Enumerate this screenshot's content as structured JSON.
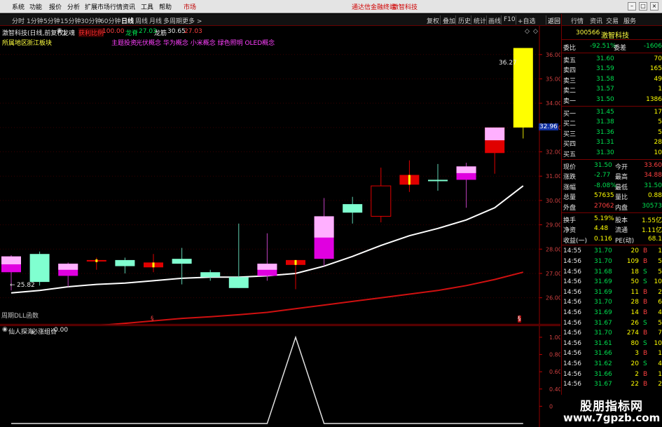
{
  "menu": {
    "items": [
      "系统",
      "功能",
      "报价",
      "分析",
      "扩展市场行情",
      "资讯",
      "工具",
      "帮助"
    ],
    "market": "市场",
    "title_app": "通达信金融终端",
    "title_stock": "激智科技"
  },
  "periods": [
    "分时",
    "1分钟",
    "5分钟",
    "15分钟",
    "30分钟",
    "60分钟",
    "日线",
    "周线",
    "月线",
    "多周期",
    "更多 >"
  ],
  "toolbar": [
    "复权",
    "叠加",
    "历史",
    "统计",
    "画线",
    "F10",
    "+自选",
    "返回"
  ],
  "chart_header": {
    "stock_line": "激智科技(日线,前复权)",
    "indicator_name": "龙魂",
    "buy_ratio_label": "获利比例",
    "buy_ratio_value": "100.00",
    "dragon_spirit_label": "龙脊",
    "dragon_spirit_value": "27.03",
    "dragon_tendon_label": "龙筋",
    "dragon_tendon_value": "30.65",
    "extra_value": "27.03",
    "region_label": "所属地区",
    "region_value": "浙江板块",
    "theme_label": "主题投资",
    "themes": "光伏概念 华为概念 小米概念 绿色照明 OLED概念"
  },
  "sub_header": {
    "name": "仙人探海",
    "formula": "必涨组合",
    "value": "0.00"
  },
  "volume_label": "周期DLL函数",
  "markers": {
    "high_label": "36.27",
    "low_label": "25.82",
    "current_price_tag": "32.96",
    "bottom_mark_left": "§",
    "bottom_mark_right": "§"
  },
  "chart_data": {
    "type": "candlestick",
    "title": "",
    "y_axis": {
      "min": 25.5,
      "max": 36.6,
      "ticks": [
        26.0,
        27.0,
        28.0,
        29.0,
        30.0,
        31.0,
        32.0,
        33.0,
        34.0,
        35.0,
        36.0
      ]
    },
    "candles": [
      {
        "open": 27.05,
        "high": 27.75,
        "low": 26.3,
        "close": 27.7,
        "color": "magenta"
      },
      {
        "open": 26.65,
        "high": 27.9,
        "low": 26.5,
        "close": 27.8,
        "color": "cyan"
      },
      {
        "open": 27.4,
        "high": 27.45,
        "low": 26.45,
        "close": 26.9,
        "color": "magenta"
      },
      {
        "open": 27.55,
        "high": 27.65,
        "low": 27.15,
        "close": 27.55,
        "color": "red"
      },
      {
        "open": 27.3,
        "high": 27.65,
        "low": 27.0,
        "close": 27.55,
        "color": "cyan"
      },
      {
        "open": 27.45,
        "high": 27.8,
        "low": 27.05,
        "close": 27.25,
        "color": "red"
      },
      {
        "open": 27.4,
        "high": 28.05,
        "low": 26.55,
        "close": 27.6,
        "color": "cyan"
      },
      {
        "open": 26.85,
        "high": 27.15,
        "low": 26.7,
        "close": 27.05,
        "color": "cyan"
      },
      {
        "open": 26.4,
        "high": 29.05,
        "low": 26.4,
        "close": 26.85,
        "color": "cyan"
      },
      {
        "open": 26.9,
        "high": 28.65,
        "low": 26.7,
        "close": 27.4,
        "color": "magenta"
      },
      {
        "open": 27.35,
        "high": 27.55,
        "low": 26.35,
        "close": 27.55,
        "color": "red"
      },
      {
        "open": 27.6,
        "high": 30.1,
        "low": 27.3,
        "close": 29.35,
        "color": "magenta"
      },
      {
        "open": 29.5,
        "high": 30.15,
        "low": 29.05,
        "close": 29.85,
        "color": "cyan"
      },
      {
        "open": 30.6,
        "high": 31.35,
        "low": 29.1,
        "close": 29.35,
        "color": "red-hollow"
      },
      {
        "open": 30.65,
        "high": 31.65,
        "low": 30.35,
        "close": 31.05,
        "color": "red"
      },
      {
        "open": 30.8,
        "high": 31.5,
        "low": 30.4,
        "close": 30.85,
        "color": "cyan"
      },
      {
        "open": 30.85,
        "high": 31.55,
        "low": 29.7,
        "close": 31.4,
        "color": "magenta"
      },
      {
        "open": 31.95,
        "high": 33.0,
        "low": 31.1,
        "close": 33.0,
        "color": "red"
      },
      {
        "open": 33.0,
        "high": 36.27,
        "low": 32.55,
        "close": 36.27,
        "color": "yellow"
      }
    ],
    "ma_white": [
      26.2,
      26.3,
      26.45,
      26.55,
      26.6,
      26.7,
      26.8,
      26.85,
      26.85,
      26.9,
      27.0,
      27.3,
      27.7,
      28.15,
      28.55,
      28.85,
      29.2,
      29.7,
      30.6
    ],
    "ma_red": [
      24.55,
      24.65,
      24.75,
      24.85,
      24.95,
      25.05,
      25.15,
      25.22,
      25.3,
      25.4,
      25.55,
      25.7,
      25.85,
      26.0,
      26.15,
      26.3,
      26.5,
      26.75,
      27.05
    ],
    "sub": {
      "y_axis": {
        "min": 0,
        "max": 1.0,
        "ticks": [
          1.0,
          0.8,
          0.6,
          0.4,
          0.2
        ]
      },
      "values": [
        0,
        0,
        0,
        0,
        0,
        0,
        0,
        0,
        0,
        0,
        1,
        0,
        0,
        0,
        0,
        0,
        0,
        0,
        0
      ]
    }
  },
  "right_panel": {
    "tabs": [
      "行情",
      "资讯",
      "交易",
      "服务"
    ],
    "code": "300566",
    "name": "激智科技",
    "ratio_label": "委比",
    "ratio_value": "-92.51%",
    "diff_label": "委差",
    "diff_value": "-1606",
    "asks": [
      {
        "label": "卖五",
        "price": "31.60",
        "vol": "70"
      },
      {
        "label": "卖四",
        "price": "31.59",
        "vol": "165"
      },
      {
        "label": "卖三",
        "price": "31.58",
        "vol": "49"
      },
      {
        "label": "卖二",
        "price": "31.57",
        "vol": "1"
      },
      {
        "label": "卖一",
        "price": "31.50",
        "vol": "1386"
      }
    ],
    "bids": [
      {
        "label": "买一",
        "price": "31.45",
        "vol": "17"
      },
      {
        "label": "买二",
        "price": "31.38",
        "vol": "5"
      },
      {
        "label": "买三",
        "price": "31.36",
        "vol": "5"
      },
      {
        "label": "买四",
        "price": "31.31",
        "vol": "28"
      },
      {
        "label": "买五",
        "price": "31.30",
        "vol": "10"
      }
    ],
    "stats": [
      {
        "l1": "现价",
        "v1": "31.50",
        "l2": "今开",
        "v2": "33.60"
      },
      {
        "l1": "涨跌",
        "v1": "-2.77",
        "l2": "最高",
        "v2": "34.88"
      },
      {
        "l1": "涨幅",
        "v1": "-8.08%",
        "l2": "最低",
        "v2": "31.50"
      },
      {
        "l1": "总量",
        "v1": "57635",
        "l2": "量比",
        "v2": "0.88"
      },
      {
        "l1": "外盘",
        "v1": "27062",
        "l2": "内盘",
        "v2": "30573"
      }
    ],
    "stats2": [
      {
        "l1": "换手",
        "v1": "5.19%",
        "l2": "股本",
        "v2": "1.55亿"
      },
      {
        "l1": "净资",
        "v1": "4.48",
        "l2": "流通",
        "v2": "1.11亿"
      },
      {
        "l1": "收益(一)",
        "v1": "0.116",
        "l2": "PE(动)",
        "v2": "68.1"
      }
    ],
    "ticks": [
      {
        "t": "14:55",
        "p": "31.70",
        "v": "20",
        "d": "B",
        "n": "1"
      },
      {
        "t": "14:56",
        "p": "31.70",
        "v": "109",
        "d": "B",
        "n": "5"
      },
      {
        "t": "14:56",
        "p": "31.68",
        "v": "18",
        "d": "S",
        "n": "5"
      },
      {
        "t": "14:56",
        "p": "31.69",
        "v": "50",
        "d": "S",
        "n": "10"
      },
      {
        "t": "14:56",
        "p": "31.69",
        "v": "11",
        "d": "B",
        "n": "2"
      },
      {
        "t": "14:56",
        "p": "31.70",
        "v": "28",
        "d": "B",
        "n": "6"
      },
      {
        "t": "14:56",
        "p": "31.69",
        "v": "14",
        "d": "B",
        "n": "4"
      },
      {
        "t": "14:56",
        "p": "31.67",
        "v": "26",
        "d": "S",
        "n": "5"
      },
      {
        "t": "14:56",
        "p": "31.70",
        "v": "274",
        "d": "B",
        "n": "7"
      },
      {
        "t": "14:56",
        "p": "31.61",
        "v": "80",
        "d": "S",
        "n": "10"
      },
      {
        "t": "14:56",
        "p": "31.66",
        "v": "3",
        "d": "B",
        "n": "1"
      },
      {
        "t": "14:56",
        "p": "31.62",
        "v": "20",
        "d": "S",
        "n": "4"
      },
      {
        "t": "14:56",
        "p": "31.66",
        "v": "2",
        "d": "B",
        "n": "1"
      },
      {
        "t": "14:56",
        "p": "31.67",
        "v": "22",
        "d": "B",
        "n": "2"
      }
    ]
  },
  "watermark": {
    "line1": "股朋指标网",
    "line2": "www.7gpzb.com"
  }
}
